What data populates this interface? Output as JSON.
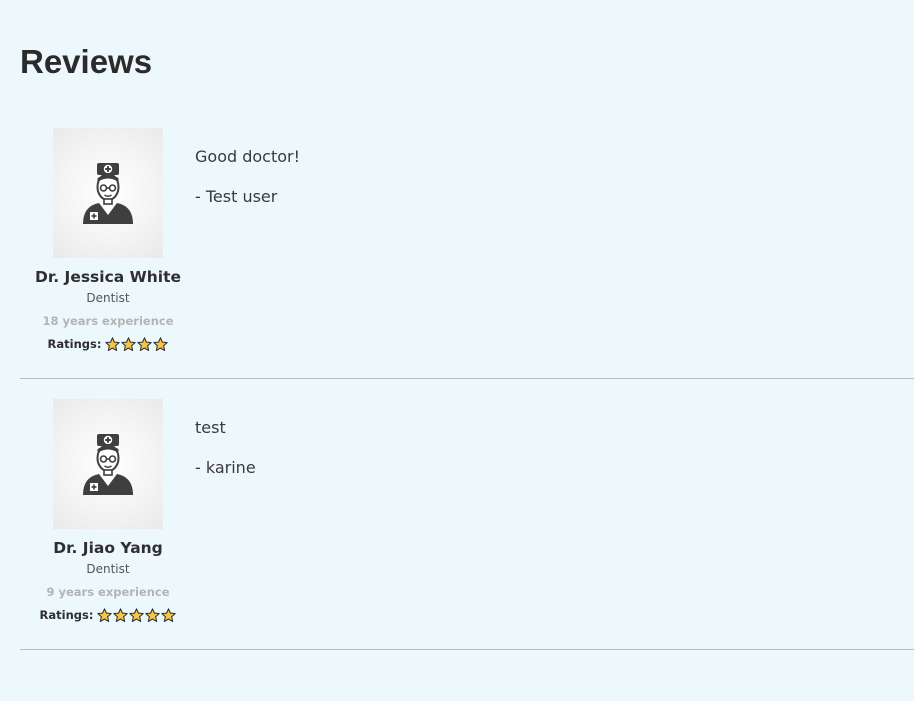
{
  "page": {
    "title": "Reviews",
    "ratings_label": "Ratings:"
  },
  "reviews": [
    {
      "doctor": {
        "name": "Dr. Jessica White",
        "specialty": "Dentist",
        "experience": "18 years experience",
        "rating": 4,
        "avatar_icon": "doctor-avatar-icon"
      },
      "text": "Good doctor!",
      "author": "- Test user"
    },
    {
      "doctor": {
        "name": "Dr. Jiao Yang",
        "specialty": "Dentist",
        "experience": "9 years experience",
        "rating": 5,
        "avatar_icon": "doctor-avatar-icon"
      },
      "text": "test",
      "author": "- karine"
    }
  ],
  "colors": {
    "background": "#ecf8fc",
    "star_fill": "#f5c542",
    "star_stroke": "#333333",
    "divider": "#b9bcbd"
  }
}
